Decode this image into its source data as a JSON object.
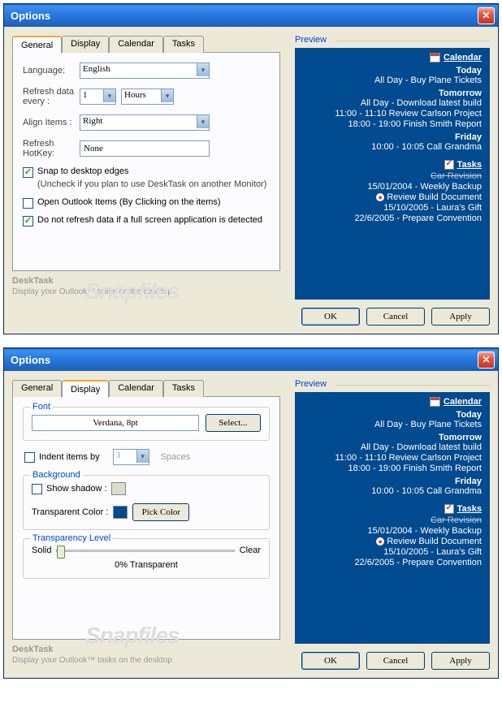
{
  "window": {
    "title": "Options"
  },
  "tabs": {
    "general": "General",
    "display": "Display",
    "calendar": "Calendar",
    "tasks": "Tasks"
  },
  "general": {
    "language_label": "Language:",
    "language_value": "English",
    "refresh_label": "Refresh data every :",
    "refresh_num": "1",
    "refresh_unit": "Hours",
    "align_label": "Align Items :",
    "align_value": "Right",
    "hotkey_label": "Refresh HotKey:",
    "hotkey_value": "None",
    "snap_label": "Snap to desktop edges",
    "snap_sub": "(Uncheck if you plan to use DeskTask on another Monitor)",
    "open_label": "Open Outlook Items (By Clicking on the items)",
    "norefresh_label": "Do not refresh data if a full screen application is detected"
  },
  "display": {
    "font_legend": "Font",
    "font_value": "Verdana, 8pt",
    "select_btn": "Select...",
    "indent_label": "Indent items by",
    "indent_num": "3",
    "indent_unit": "Spaces",
    "bg_legend": "Background",
    "shadow_label": "Show shadow :",
    "trans_color_label": "Transparent Color :",
    "pick_btn": "Pick Color",
    "trans_level_legend": "Transparency Level",
    "solid": "Solid",
    "clear": "Clear",
    "trans_pct": "0% Transparent",
    "shadow_swatch": "#dcdccc",
    "trans_swatch": "#004a8f"
  },
  "preview": {
    "label": "Preview",
    "cal_heading": "Calendar",
    "tasks_heading": "Tasks",
    "days": [
      {
        "name": "Today",
        "items": [
          "All Day - Buy Plane Tickets"
        ]
      },
      {
        "name": "Tomorrow",
        "items": [
          "All Day - Download latest build",
          "11:00 - 11:10 Review Carlson Project",
          "18:00 - 19:00 Finish Smith Report"
        ]
      },
      {
        "name": "Friday",
        "items": [
          "10:00 - 10:05 Call Grandma"
        ]
      }
    ],
    "tasks": [
      {
        "text": "Car Revision",
        "strike": true
      },
      {
        "text": "15/01/2004 - Weekly Backup"
      },
      {
        "text": "Review Build Document",
        "alert": true
      },
      {
        "text": "15/10/2005 - Laura's Gift"
      },
      {
        "text": "22/6/2005 - Prepare Convention"
      }
    ]
  },
  "footer": {
    "brand": "DeskTask",
    "sub": "Display your Outlook™ tasks on the desktop",
    "ok": "OK",
    "cancel": "Cancel",
    "apply": "Apply"
  }
}
